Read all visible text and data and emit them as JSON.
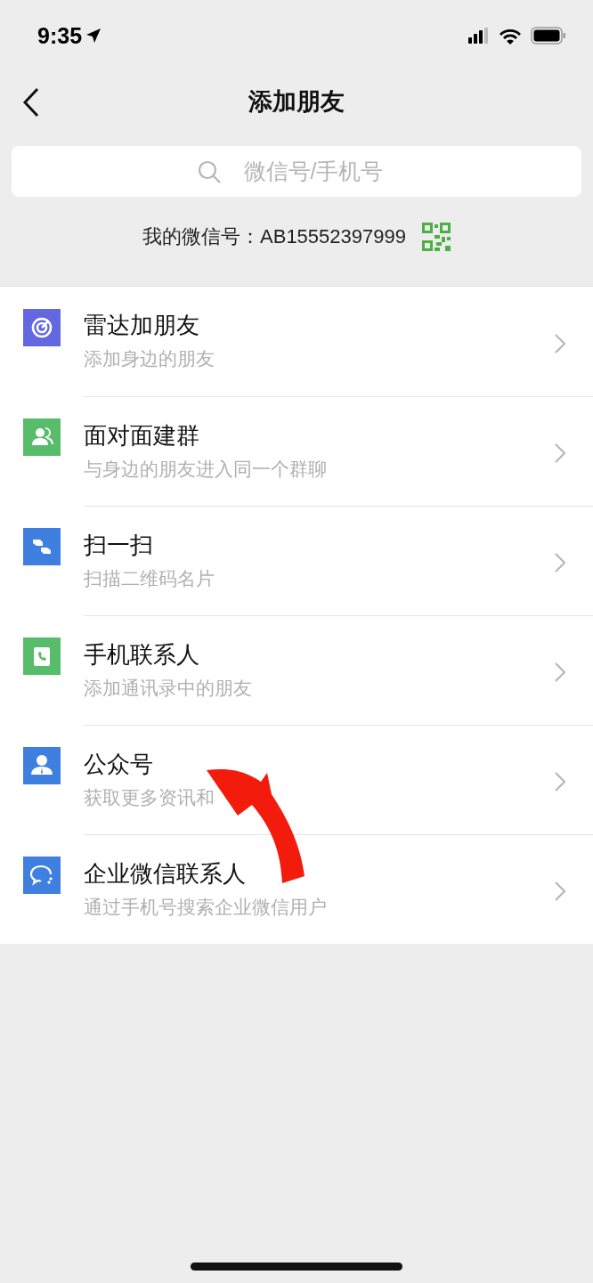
{
  "status_bar": {
    "time": "9:35"
  },
  "nav": {
    "title": "添加朋友"
  },
  "search": {
    "placeholder": "微信号/手机号"
  },
  "my_id": {
    "label": "我的微信号：AB15552397999"
  },
  "items": [
    {
      "kind": "radar",
      "color": "#6468e0",
      "title": "雷达加朋友",
      "subtitle": "添加身边的朋友"
    },
    {
      "kind": "group",
      "color": "#57bd6a",
      "title": "面对面建群",
      "subtitle": "与身边的朋友进入同一个群聊"
    },
    {
      "kind": "scan",
      "color": "#3e7fe0",
      "title": "扫一扫",
      "subtitle": "扫描二维码名片"
    },
    {
      "kind": "phone",
      "color": "#57bd6a",
      "title": "手机联系人",
      "subtitle": "添加通讯录中的朋友"
    },
    {
      "kind": "official",
      "color": "#3e7fe0",
      "title": "公众号",
      "subtitle": "获取更多资讯和"
    },
    {
      "kind": "work",
      "color": "#3e7fe0",
      "title": "企业微信联系人",
      "subtitle": "通过手机号搜索企业微信用户"
    }
  ]
}
